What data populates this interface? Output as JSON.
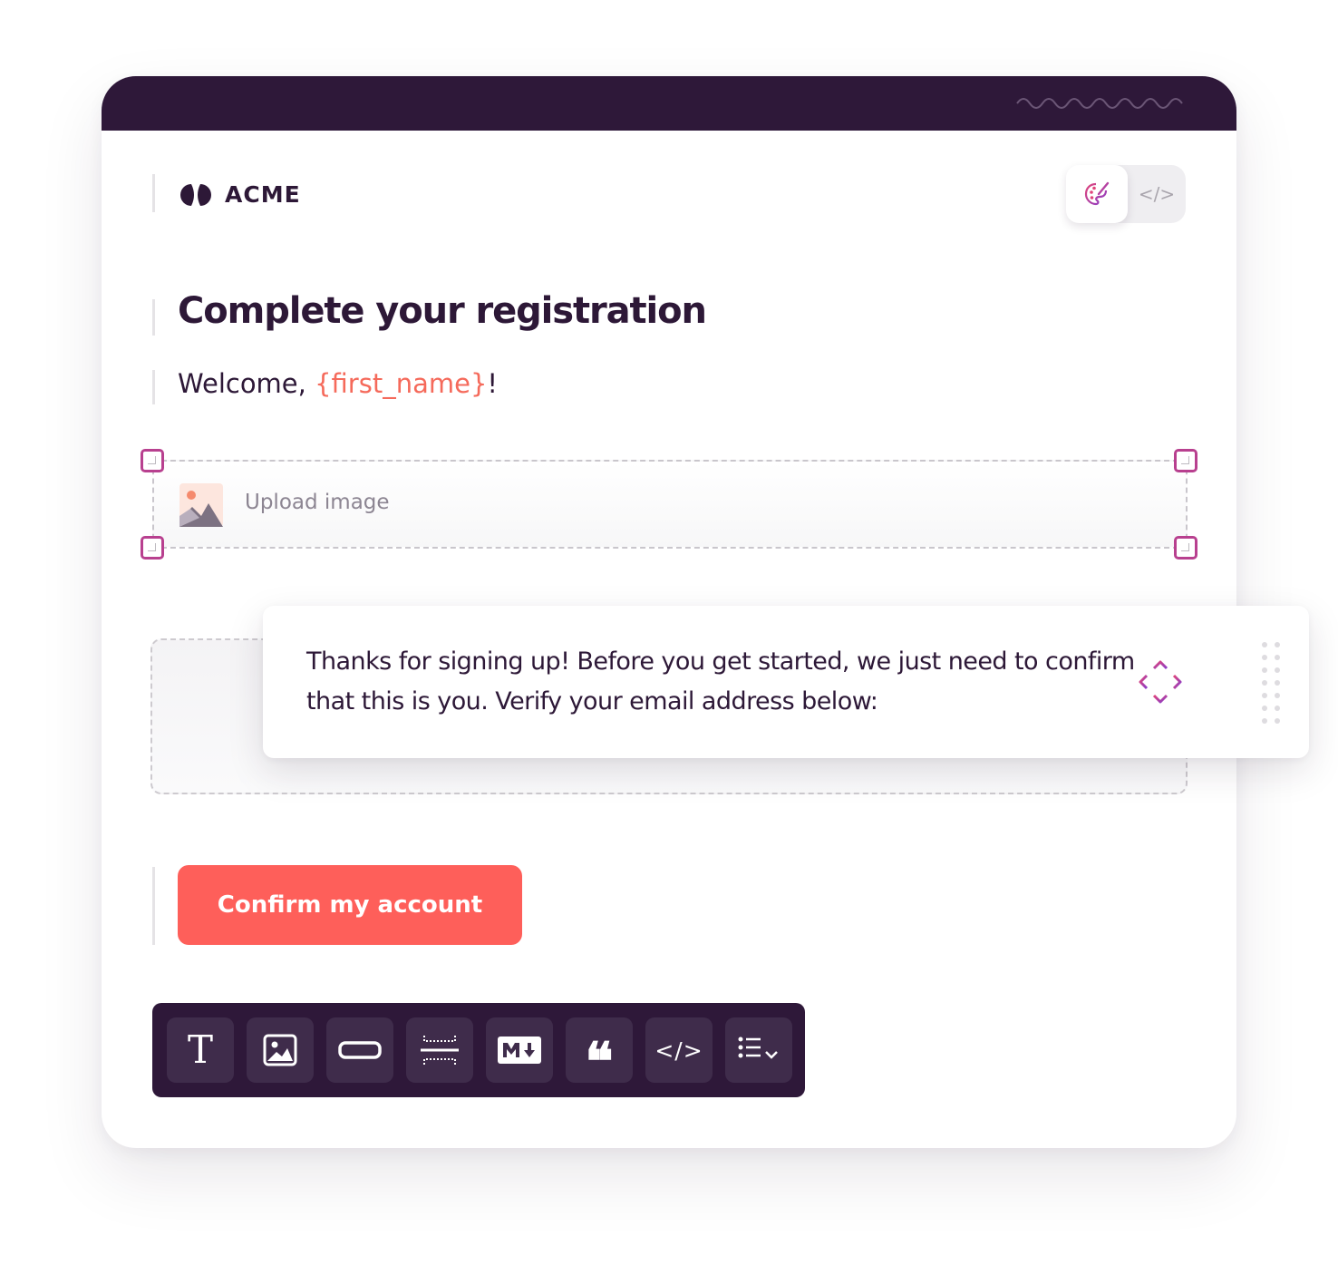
{
  "brand": {
    "name": "ACME",
    "logo_icon": "acme-logo-icon"
  },
  "mode_toggle": {
    "design_icon": "palette-icon",
    "code_label": "</>"
  },
  "email": {
    "title": "Complete your registration",
    "welcome_prefix": "Welcome, ",
    "welcome_variable": "{first_name}",
    "welcome_suffix": "!",
    "upload_label": "Upload image",
    "body_text": "Thanks for signing up! Before you get started, we just need to confirm that this is you. Verify your email address below:",
    "cta_label": "Confirm my account"
  },
  "toolbar": {
    "items": [
      {
        "name": "text",
        "label": "T",
        "icon": "text-icon"
      },
      {
        "name": "image",
        "icon": "image-icon"
      },
      {
        "name": "button",
        "icon": "button-block-icon"
      },
      {
        "name": "divider",
        "icon": "divider-icon"
      },
      {
        "name": "markdown",
        "icon": "markdown-icon"
      },
      {
        "name": "quote",
        "label": "❝",
        "icon": "quote-icon"
      },
      {
        "name": "code",
        "label": "</>",
        "icon": "code-icon"
      },
      {
        "name": "list",
        "icon": "list-icon"
      }
    ]
  },
  "colors": {
    "header_bg": "#2e1839",
    "text_primary": "#2d1837",
    "accent_coral": "#fe5f5a",
    "variable_color": "#f56a5b",
    "handle_gradient_start": "#e0457b",
    "handle_gradient_end": "#8a3ec9"
  }
}
